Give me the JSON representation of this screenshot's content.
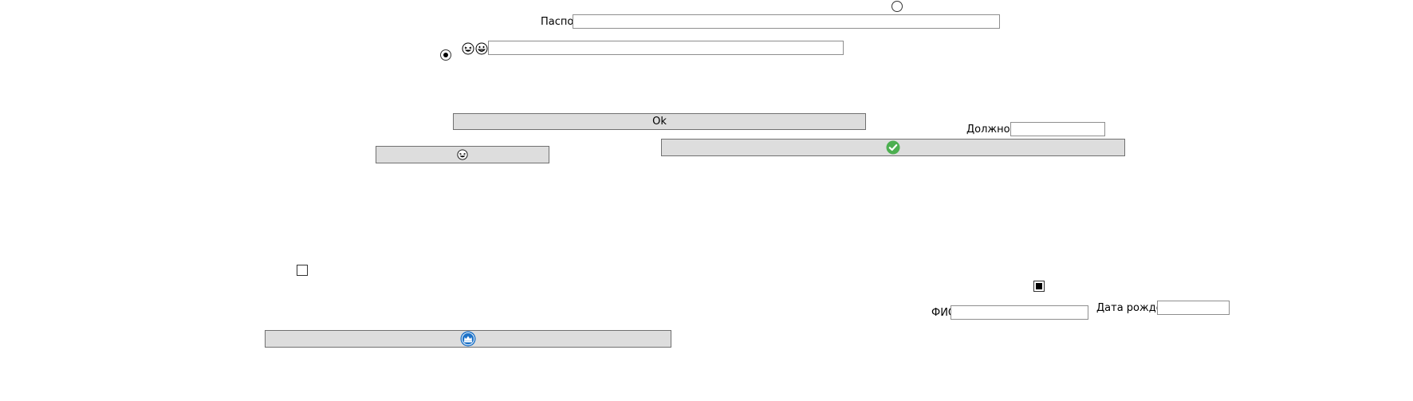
{
  "form": {
    "passport_label": "Паспорт",
    "passport_value": "",
    "position_label": "Должность",
    "position_value": "",
    "fio_label": "ФИО",
    "fio_value": "",
    "birthdate_label": "Дата рождения",
    "birthdate_value": "",
    "emoji_field_value": ""
  },
  "buttons": {
    "ok_label": "Ok"
  },
  "controls": {
    "radio_top_checked": false,
    "radio_left_checked": true,
    "checkbox_left_state": "unchecked",
    "checkbox_right_state": "indeterminate"
  },
  "icons": {
    "emoji_small_1": "grinning-squint-emoji-icon",
    "emoji_small_2": "grinning-emoji-icon",
    "emoji_button": "grinning-squint-emoji-icon",
    "check_button": "check-circle-icon",
    "bottom_button": "blue-crown-badge-icon"
  },
  "colors": {
    "button_bg": "#dddddd",
    "check_green": "#4caf50",
    "badge_blue": "#1e73c8"
  }
}
